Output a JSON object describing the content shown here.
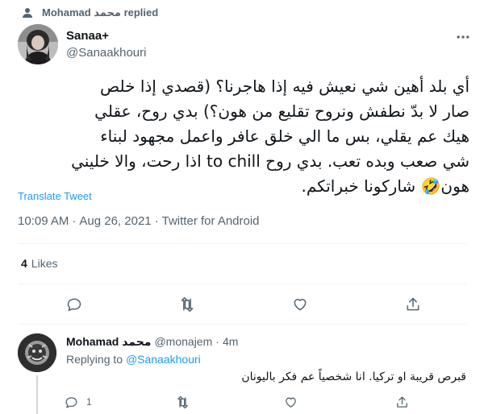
{
  "context": {
    "icon": "person-icon",
    "label": "Mohamad محمد replied"
  },
  "tweet": {
    "author_name": "Sanaa+",
    "author_handle": "@Sanaakhouri",
    "text_lines": [
      "أي بلد أهين شي نعيش فيه إذا هاجرنا؟ (قصدي إذا خلص",
      "صار لا بدّ نطفش ونروح تقليع من هون؟) بدي روح، عقلي",
      "هيك عم يقلي، بس ما الي خلق عافر واعمل مجهود لبناء",
      "شي صعب وبده تعب. بدي روح to chill اذا رحت، والا خليني",
      "هون🤣 شاركونا خبراتكم."
    ],
    "translate_label": "Translate Tweet",
    "time": "10:09 AM",
    "sep1": "·",
    "date": "Aug 26, 2021",
    "sep2": "·",
    "source": "Twitter for Android",
    "likes_count": "4",
    "likes_label": "Likes"
  },
  "reply": {
    "author_name": "Mohamad محمد",
    "author_handle": "@monajem",
    "sep": "·",
    "time": "4m",
    "replying_label": "Replying to",
    "replying_to": "@Sanaakhouri",
    "text": "قبرص قريبة او تركيا. انا شخصياً عم فكر باليونان",
    "reply_count": "1"
  },
  "colors": {
    "accent": "#1d9bf0",
    "muted": "#536471",
    "text": "#0f1419"
  }
}
